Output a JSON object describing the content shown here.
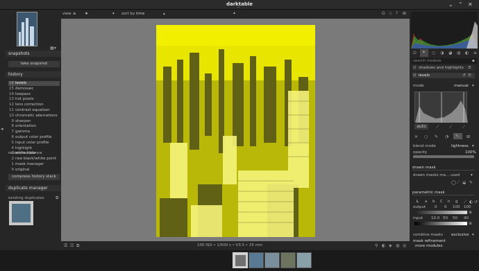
{
  "window": {
    "title": "darktable"
  },
  "left_panel": {
    "snapshots": {
      "header": "snapshots",
      "button": "take snapshot"
    },
    "history": {
      "header": "history",
      "items": [
        {
          "n": "16",
          "label": "levels"
        },
        {
          "n": "15",
          "label": "demosaic"
        },
        {
          "n": "14",
          "label": "lowpass"
        },
        {
          "n": "13",
          "label": "hot pixels"
        },
        {
          "n": "12",
          "label": "lens correction"
        },
        {
          "n": "11",
          "label": "contrast equalizer"
        },
        {
          "n": "10",
          "label": "chromatic aberrations"
        },
        {
          "n": "9",
          "label": "sharpen"
        },
        {
          "n": "8",
          "label": "orientation"
        },
        {
          "n": "7",
          "label": "gamma"
        },
        {
          "n": "6",
          "label": "output color profile"
        },
        {
          "n": "5",
          "label": "input color profile"
        },
        {
          "n": "4",
          "label": "highlight reconstruction"
        },
        {
          "n": "3",
          "label": "white balance"
        },
        {
          "n": "2",
          "label": "raw black/white point"
        },
        {
          "n": "1",
          "label": "mask manager"
        },
        {
          "n": "0",
          "label": "original"
        }
      ],
      "compress_button": "compress history stack"
    },
    "duplicate_manager": {
      "header": "duplicate manager",
      "existing_label": "existing duplicates"
    }
  },
  "top_toolbar": {
    "view_label": "view",
    "view_value": "≥",
    "stars_value": "★",
    "sort_label": "sort by",
    "sort_value": "time"
  },
  "bottom_bar": {
    "image_info": "100 ISO • 1/500 s • f/3.5 • 25 mm"
  },
  "right_panel": {
    "search_placeholder": "search module",
    "shadows_header": "shadows and highlights",
    "levels_header": "levels",
    "mode_label": "mode",
    "mode_value": "manual",
    "auto_button": "auto",
    "blend_mode_label": "blend mode",
    "blend_mode_value": "lightness",
    "opacity_label": "opacity",
    "opacity_value": "100%",
    "opacity_fraction": 1.0,
    "drawn_mask_header": "drawn mask",
    "drawn_mask_row": "drawn masks ma... used",
    "parametric_mask_header": "parametric mask",
    "channel_l": "L",
    "channel_a": "a",
    "channel_b": "b",
    "channel_c": "C",
    "channel_h": "h",
    "channel_g": "g",
    "output_label": "output",
    "output_values": [
      "0",
      "0",
      "100",
      "100"
    ],
    "input_label": "input",
    "input_values": [
      "10.0",
      "50",
      "50",
      "90"
    ],
    "combine_label": "combine masks",
    "combine_value": "exclusive",
    "mask_refinement": "mask refinement",
    "more_modules": "more modules"
  },
  "colors": {
    "accent_yellow": "#e6e400",
    "panel_bg": "#262626",
    "center_bg": "#7a7a7a"
  }
}
